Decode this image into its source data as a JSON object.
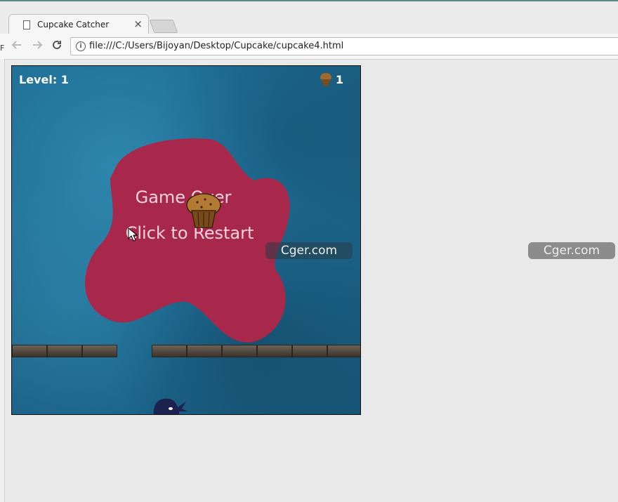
{
  "browser": {
    "tab_title": "Cupcake Catcher",
    "tab_close": "×",
    "url": "file:///C:/Users/Bijoyan/Desktop/Cupcake/cupcake4.html",
    "back_icon": "arrow-left-icon",
    "forward_icon": "arrow-right-icon",
    "reload_icon": "reload-icon",
    "info_icon": "info-icon"
  },
  "sidebar": {
    "letter": "F"
  },
  "game": {
    "level_text": "Level: 1",
    "score": "1",
    "gameover_line1": "Game Over",
    "gameover_line2": "Click to Restart",
    "colors": {
      "background": "#1f6f97",
      "blob": "#a8284c",
      "text": "#f4d3dc"
    }
  },
  "watermarks": [
    "Cger.com",
    "Cger.com"
  ]
}
